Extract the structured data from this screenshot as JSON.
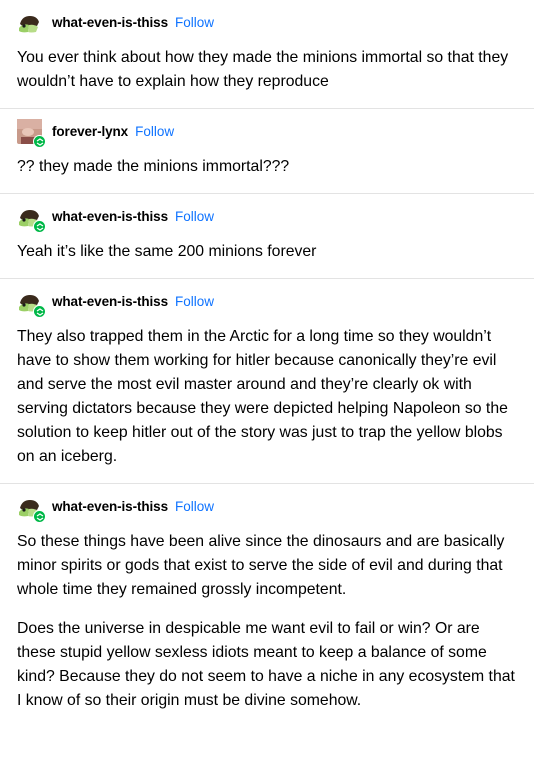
{
  "colors": {
    "follow": "#0f73ff",
    "reblog_badge": "#00b848",
    "divider": "#e3e3e3"
  },
  "posts": [
    {
      "username": "what-even-is-thiss",
      "follow_label": "Follow",
      "avatar_icon": "frog-avatar",
      "reblog_badge": false,
      "paragraphs": [
        "You ever think about how they made the minions immortal so that they wouldn’t have to explain how they reproduce"
      ]
    },
    {
      "username": "forever-lynx",
      "follow_label": "Follow",
      "avatar_icon": "portrait-avatar",
      "reblog_badge": true,
      "paragraphs": [
        "?? they made the minions immortal???"
      ]
    },
    {
      "username": "what-even-is-thiss",
      "follow_label": "Follow",
      "avatar_icon": "frog-avatar",
      "reblog_badge": true,
      "paragraphs": [
        "Yeah it’s like the same 200 minions forever"
      ]
    },
    {
      "username": "what-even-is-thiss",
      "follow_label": "Follow",
      "avatar_icon": "frog-avatar",
      "reblog_badge": true,
      "paragraphs": [
        "They also trapped them in the Arctic for a long time so they wouldn’t have to show them working for hitler because canonically they’re evil and serve the most evil master around and they’re clearly ok with serving dictators because they were depicted helping Napoleon so the solution to keep hitler out of the story was just to trap the yellow blobs on an iceberg."
      ]
    },
    {
      "username": "what-even-is-thiss",
      "follow_label": "Follow",
      "avatar_icon": "frog-avatar",
      "reblog_badge": true,
      "paragraphs": [
        "So these things have been alive since the dinosaurs and are basically minor spirits or gods that exist to serve the side of evil and during that whole time they remained grossly incompetent.",
        "Does the universe in despicable me want evil to fail or win? Or are these stupid yellow sexless idiots meant to keep a balance of some kind? Because they do not seem to have a niche in any ecosystem that I know of so their origin must be divine somehow."
      ]
    }
  ]
}
